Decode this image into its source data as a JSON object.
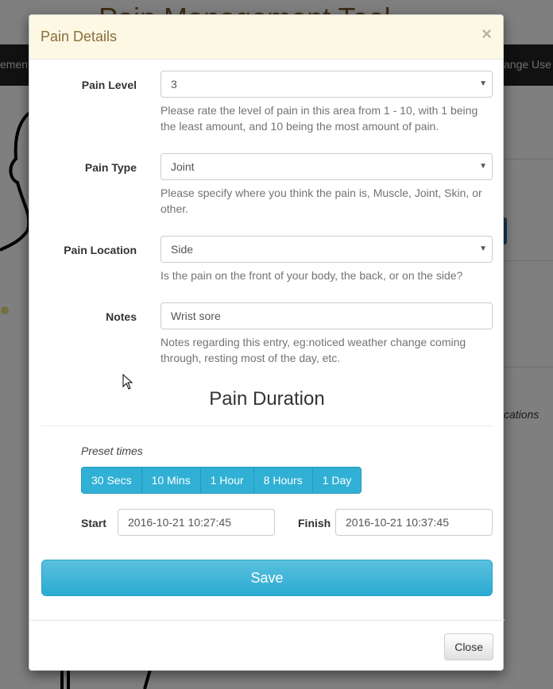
{
  "background": {
    "title": "Pain Management Tool",
    "nav_left": "ement",
    "nav_right": "ange Use",
    "right_text": "cations"
  },
  "modal": {
    "title": "Pain Details",
    "close_x": "×",
    "fields": {
      "pain_level": {
        "label": "Pain Level",
        "value": "3",
        "help": "Please rate the level of pain in this area from 1 - 10, with 1 being the least amount, and 10 being the most amount of pain."
      },
      "pain_type": {
        "label": "Pain Type",
        "value": "Joint",
        "help": "Please specify where you think the pain is, Muscle, Joint, Skin, or other."
      },
      "pain_location": {
        "label": "Pain Location",
        "value": "Side",
        "help": "Is the pain on the front of your body, the back, or on the side?"
      },
      "notes": {
        "label": "Notes",
        "value": "Wrist sore",
        "help": "Notes regarding this entry, eg:noticed weather change coming through, resting most of the day, etc."
      }
    },
    "duration": {
      "title": "Pain Duration",
      "preset_label": "Preset times",
      "presets": [
        "30 Secs",
        "10 Mins",
        "1 Hour",
        "8 Hours",
        "1 Day"
      ],
      "start_label": "Start",
      "start_value": "2016-10-21 10:27:45",
      "finish_label": "Finish",
      "finish_value": "2016-10-21 10:37:45"
    },
    "save_label": "Save",
    "close_label": "Close"
  },
  "colors": {
    "header_bg": "#fcf8e3",
    "title_color": "#8a6d3b",
    "info_button": "#31b0d5"
  },
  "icons": {
    "select_caret": "caret-down-icon",
    "close": "close-icon",
    "cursor": "mouse-pointer-icon"
  }
}
